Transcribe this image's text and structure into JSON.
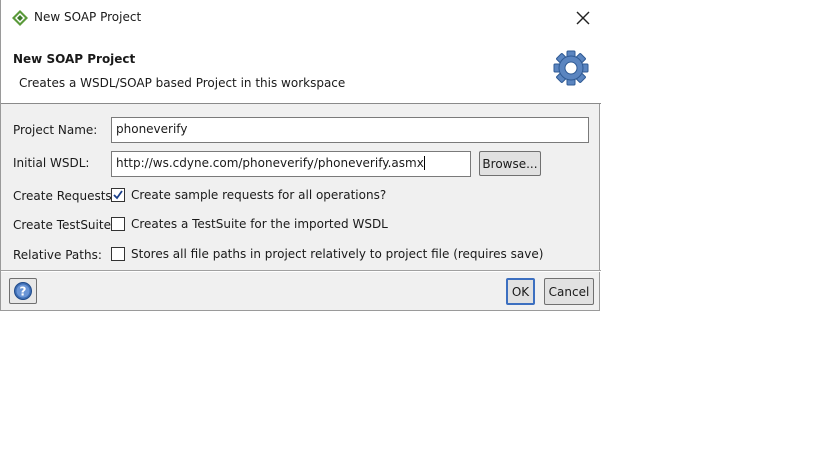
{
  "window": {
    "title": "New SOAP Project",
    "app_icon": "soapui-diamond-icon",
    "close_icon": "close-icon"
  },
  "header": {
    "title": "New SOAP Project",
    "description": "Creates a WSDL/SOAP based Project in this workspace",
    "icon": "gear-icon"
  },
  "form": {
    "project_name_label": "Project Name:",
    "project_name_value": "phoneverify",
    "initial_wsdl_label": "Initial WSDL:",
    "initial_wsdl_value": "http://ws.cdyne.com/phoneverify/phoneverify.asmx",
    "browse_label": "Browse...",
    "create_requests_label": "Create Requests:",
    "create_requests_text": "Create sample requests for all operations?",
    "create_requests_checked": true,
    "create_testsuite_label": "Create TestSuite:",
    "create_testsuite_text": "Creates a TestSuite for the imported WSDL",
    "create_testsuite_checked": false,
    "relative_paths_label": "Relative Paths:",
    "relative_paths_text": "Stores all file paths in project relatively to project file (requires save)",
    "relative_paths_checked": false
  },
  "footer": {
    "help_icon": "help-icon",
    "ok_label": "OK",
    "cancel_label": "Cancel"
  },
  "colors": {
    "dialog_bg": "#f0f0f0",
    "header_bg": "#ffffff",
    "gear_blue": "#4a78b8"
  }
}
